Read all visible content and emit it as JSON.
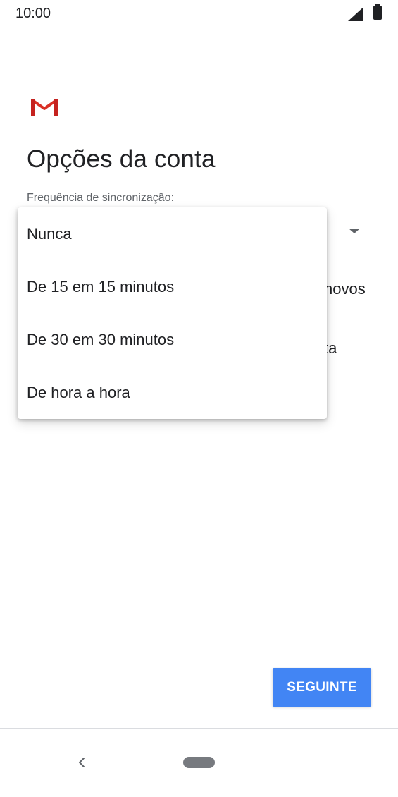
{
  "status_bar": {
    "time": "10:00",
    "signal_icon": "cellular-signal-icon",
    "battery_icon": "battery-icon"
  },
  "app": {
    "logo_icon": "gmail-logo-icon",
    "brand_color": "#d93025"
  },
  "page": {
    "title": "Opções da conta",
    "sync_label": "Frequência de sincronização:",
    "behind_text_1": "novos",
    "behind_text_2": "ta"
  },
  "dropdown": {
    "options": [
      {
        "label": "Nunca"
      },
      {
        "label": "De 15 em 15 minutos"
      },
      {
        "label": "De 30 em 30 minutos"
      },
      {
        "label": "De hora a hora"
      }
    ]
  },
  "actions": {
    "next_label": "SEGUINTE",
    "accent_color": "#4285f4"
  },
  "nav_bar": {
    "back_icon": "back-chevron-icon",
    "home_icon": "home-pill-icon"
  }
}
